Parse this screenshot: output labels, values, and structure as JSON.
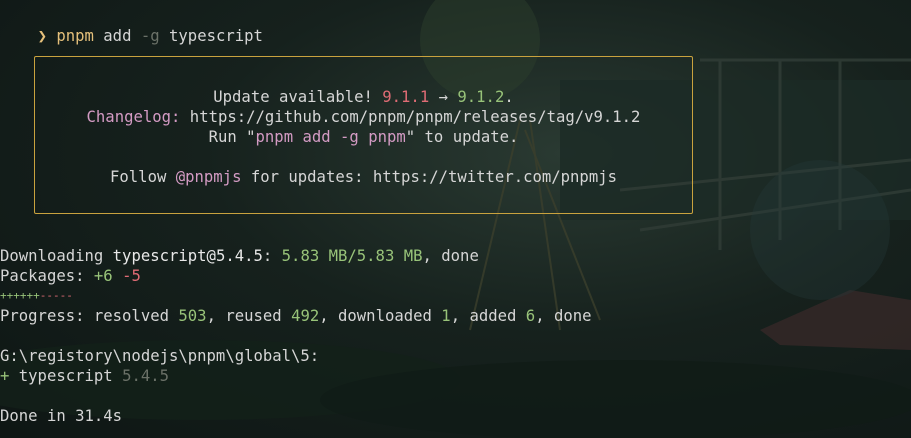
{
  "terminal": {
    "prompt_symbol": "❯",
    "command": {
      "program": "pnpm",
      "action": "add",
      "flag": "-g",
      "package": "typescript"
    },
    "update_box": {
      "line1_prefix": "Update available! ",
      "from_version": "9.1.1",
      "arrow": " → ",
      "to_version": "9.1.2",
      "line1_suffix": ".",
      "changelog_label": "Changelog:",
      "changelog_url": " https://github.com/pnpm/pnpm/releases/tag/v9.1.2",
      "run_prefix": "Run \"",
      "run_command": "pnpm add -g pnpm",
      "run_suffix": "\" to update.",
      "follow_prefix": "Follow ",
      "follow_handle": "@pnpmjs",
      "follow_suffix": " for updates: https://twitter.com/pnpmjs"
    },
    "download": {
      "prefix": "Downloading ",
      "package": "typescript@5.4.5",
      "colon": ": ",
      "progress": "5.83 MB/5.83 MB",
      "suffix": ", done"
    },
    "packages": {
      "label": "Packages: ",
      "added": "+6",
      "removed": "-5"
    },
    "diff_bar": {
      "plus": "++++++",
      "minus": "-----"
    },
    "progress": {
      "prefix": "Progress: resolved ",
      "resolved": "503",
      "reused_label": ", reused ",
      "reused": "492",
      "downloaded_label": ", downloaded ",
      "downloaded": "1",
      "added_label": ", added ",
      "added": "6",
      "suffix": ", done"
    },
    "global_path": "G:\\registory\\nodejs\\pnpm\\global\\5:",
    "installed": {
      "marker": "+",
      "name": " typescript ",
      "version": "5.4.5"
    },
    "done": "Done in 31.4s"
  },
  "colors": {
    "yellow": "#e5c07b",
    "green": "#98c379",
    "red": "#e06c75",
    "pink": "#d49bc4",
    "border": "#c9a23e"
  }
}
